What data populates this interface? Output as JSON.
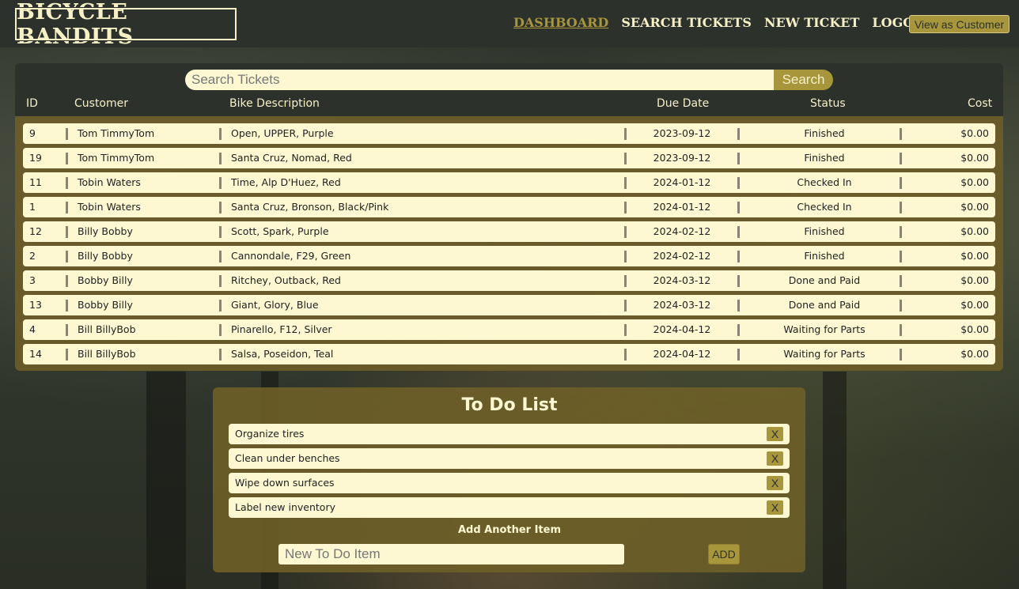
{
  "header": {
    "logo": "BICYCLE BANDITS",
    "nav": [
      "DASHBOARD",
      "SEARCH TICKETS",
      "NEW TICKET",
      "LOGOUT"
    ],
    "active_nav": "DASHBOARD",
    "view_as_customer": "View as Customer"
  },
  "search": {
    "placeholder": "Search Tickets",
    "button": "Search"
  },
  "table": {
    "columns": [
      "ID",
      "Customer",
      "Bike Description",
      "Due Date",
      "Status",
      "Cost"
    ],
    "rows": [
      {
        "id": "9",
        "customer": "Tom TimmyTom",
        "bike": "Open, UPPER, Purple",
        "due": "2023-09-12",
        "status": "Finished",
        "cost": "$0.00"
      },
      {
        "id": "19",
        "customer": "Tom TimmyTom",
        "bike": "Santa Cruz, Nomad, Red",
        "due": "2023-09-12",
        "status": "Finished",
        "cost": "$0.00"
      },
      {
        "id": "11",
        "customer": "Tobin Waters",
        "bike": "Time, Alp D'Huez, Red",
        "due": "2024-01-12",
        "status": "Checked In",
        "cost": "$0.00"
      },
      {
        "id": "1",
        "customer": "Tobin Waters",
        "bike": "Santa Cruz, Bronson, Black/Pink",
        "due": "2024-01-12",
        "status": "Checked In",
        "cost": "$0.00"
      },
      {
        "id": "12",
        "customer": "Billy Bobby",
        "bike": "Scott, Spark, Purple",
        "due": "2024-02-12",
        "status": "Finished",
        "cost": "$0.00"
      },
      {
        "id": "2",
        "customer": "Billy Bobby",
        "bike": "Cannondale, F29, Green",
        "due": "2024-02-12",
        "status": "Finished",
        "cost": "$0.00"
      },
      {
        "id": "3",
        "customer": "Bobby Billy",
        "bike": "Ritchey, Outback, Red",
        "due": "2024-03-12",
        "status": "Done and Paid",
        "cost": "$0.00"
      },
      {
        "id": "13",
        "customer": "Bobby Billy",
        "bike": "Giant, Glory, Blue",
        "due": "2024-03-12",
        "status": "Done and Paid",
        "cost": "$0.00"
      },
      {
        "id": "4",
        "customer": "Bill BillyBob",
        "bike": "Pinarello, F12, Silver",
        "due": "2024-04-12",
        "status": "Waiting for Parts",
        "cost": "$0.00"
      },
      {
        "id": "14",
        "customer": "Bill BillyBob",
        "bike": "Salsa, Poseidon, Teal",
        "due": "2024-04-12",
        "status": "Waiting for Parts",
        "cost": "$0.00"
      }
    ]
  },
  "todo": {
    "title": "To Do List",
    "items": [
      "Organize tires",
      "Clean under benches",
      "Wipe down surfaces",
      "Label new inventory"
    ],
    "remove_label": "X",
    "add_label": "Add Another Item",
    "new_placeholder": "New To Do Item",
    "add_button": "ADD"
  },
  "colors": {
    "header_bg": "#2c312c",
    "accent": "#a8963c",
    "cream": "#fdf8d2",
    "panel_olive": "#6e5f28"
  }
}
